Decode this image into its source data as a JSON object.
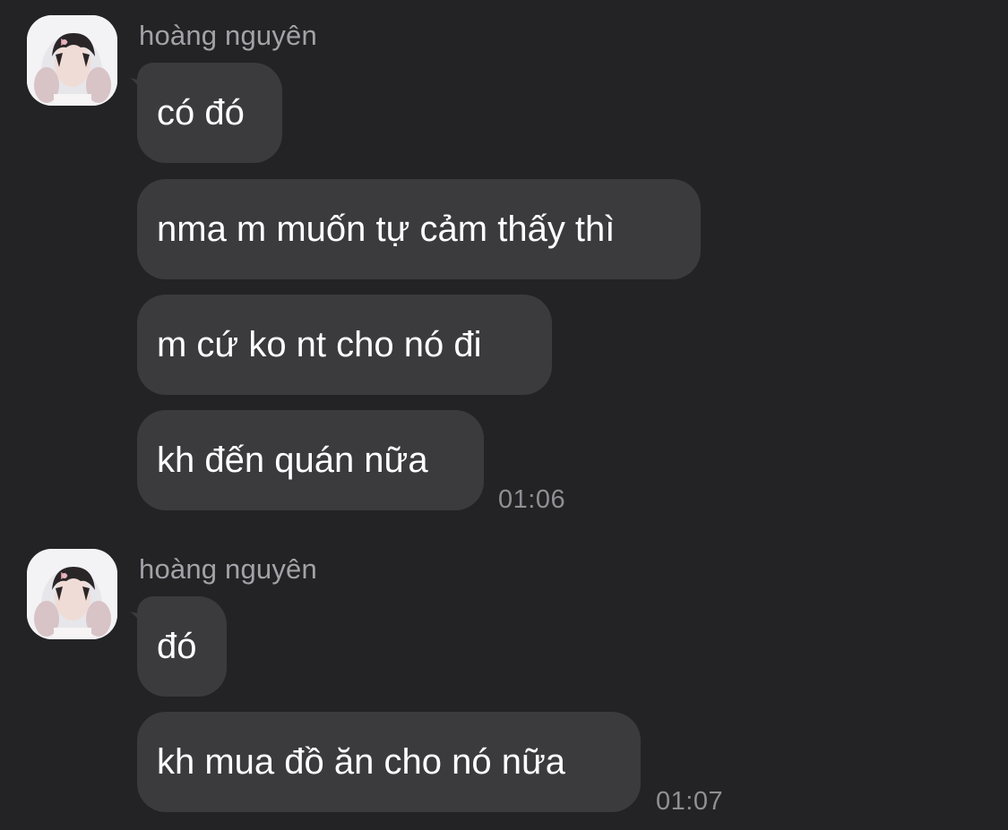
{
  "chat": {
    "groups": [
      {
        "sender": "hoàng nguyên",
        "messages": [
          "có đó",
          "nma m muốn tự cảm thấy thì",
          "m cứ ko nt cho nó đi",
          "kh đến quán nữa"
        ],
        "time": "01:06"
      },
      {
        "sender": "hoàng nguyên",
        "messages": [
          "đó",
          "kh mua đồ ăn cho nó nữa"
        ],
        "time": "01:07"
      }
    ]
  },
  "theme": {
    "background": "#232325",
    "bubble": "#3b3b3e",
    "text": "#ffffff",
    "meta_text": "#a2a2a8"
  }
}
